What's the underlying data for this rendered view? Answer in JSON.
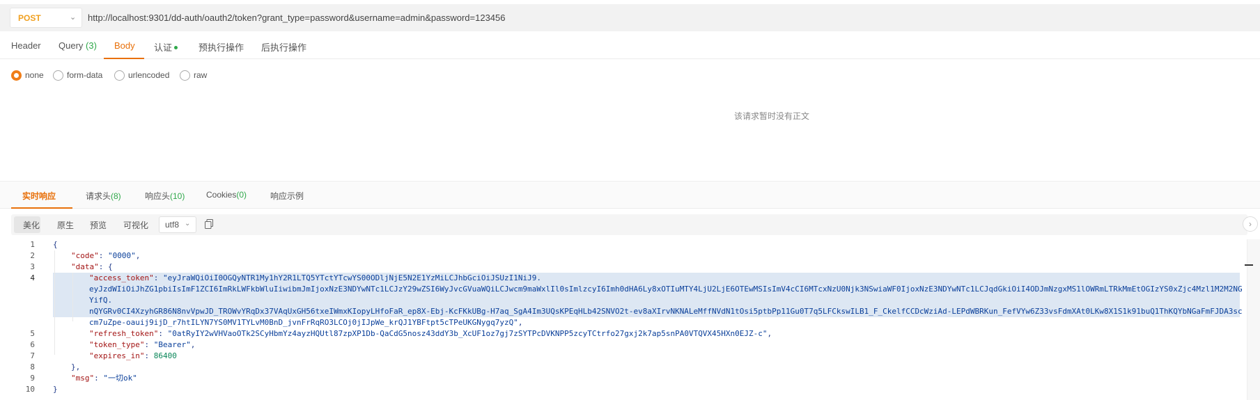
{
  "request": {
    "method": "POST",
    "url": "http://localhost:9301/dd-auth/oauth2/token?grant_type=password&username=admin&password=123456"
  },
  "request_tabs": [
    {
      "label": "Header",
      "count": ""
    },
    {
      "label": "Query",
      "count": "(3)"
    },
    {
      "label": "Body",
      "count": ""
    },
    {
      "label": "认证",
      "count": ""
    },
    {
      "label": "预执行操作",
      "count": ""
    },
    {
      "label": "后执行操作",
      "count": ""
    }
  ],
  "active_request_tab": "Body",
  "body_types": [
    {
      "label": "none",
      "selected": true
    },
    {
      "label": "form-data",
      "selected": false
    },
    {
      "label": "urlencoded",
      "selected": false
    },
    {
      "label": "raw",
      "selected": false
    }
  ],
  "body_empty_text": "该请求暂时没有正文",
  "response_tabs": [
    {
      "label": "实时响应",
      "count": ""
    },
    {
      "label": "请求头",
      "count": "(8)"
    },
    {
      "label": "响应头",
      "count": "(10)"
    },
    {
      "label": "Cookies",
      "count": "(0)"
    },
    {
      "label": "响应示例",
      "count": ""
    }
  ],
  "active_response_tab": "实时响应",
  "view_modes": [
    "美化",
    "原生",
    "预览",
    "可视化"
  ],
  "active_view_mode": "美化",
  "encoding": "utf8",
  "code": {
    "line_numbers": [
      "1",
      "2",
      "3",
      "4",
      "5",
      "6",
      "7",
      "8",
      "9",
      "10"
    ],
    "current_line": "4",
    "open_brace": "{",
    "close_brace": "}",
    "code_key": "\"code\"",
    "code_value": "\"0000\"",
    "data_key": "\"data\"",
    "access_token_key": "\"access_token\"",
    "access_token_value_1": "\"eyJraWQiOiI0OGQyNTR1My1hY2R1LTQ5YTctYTcwYS00ODljNjE5N2E1YzMiLCJhbGciOiJSUzI1NiJ9.",
    "access_token_value_2": "eyJzdWIiOiJhZG1pbiIsImF1ZCI6ImRkLWFkbWluIiwibmJmIjoxNzE3NDYwNTc1LCJzY29wZSI6WyJvcGVuaWQiLCJwcm9maWxlIl0sImlzcyI6Imh0dHA6Ly8xOTIuMTY4LjU2LjE6OTEwMSIsImV4cCI6MTcxNzU0Njk3NSwiaWF0IjoxNzE3NDYwNTc1LCJqdGkiOiI4ODJmNzgxMS1lOWRmLTRkMmEtOGIzYS0xZjc4Mzl1M2M2NG",
    "access_token_value_3": "YifQ.",
    "access_token_value_4": "nQYGRv0CI4XzyhGR86N8nvVpwJD_TROWvYRqDx37VAqUxGH56txeIWmxKIopyLHfoFaR_ep8X-Ebj-KcFKkUBg-H7aq_SgA4Im3UQsKPEqHLb42SNVO2t-ev8aXIrvNKNALeMffNVdN1tOsi5ptbPp11Gu0T7q5LFCkswILB1_F_CkelfCCDcWziAd-LEPdWBRKun_FefVYw6Z33vsFdmXAt0LKw8X1S1k91buQ1ThKQYbNGaFmFJDA3sc",
    "access_token_value_5": "cm7uZpe-oauij9ijD_r7htILYN7YS0MV1TYLvM0BnD_jvnFrRqRO3LCOj0jIJpWe_krQJ1YBFtpt5cTPeUKGNygq7yzQ\"",
    "refresh_token_key": "\"refresh_token\"",
    "refresh_token_value": "\"0atRyIY2wVHVaoOTk2SCyHbmYz4ayzHQUtl87zpXP1Db-QaCdG5nosz43ddY3b_XcUF1oz7gj7zSYTPcDVKNPP5zcyTCtrfo27gxj2k7ap5snPA0VTQVX45HXn0EJZ-c\"",
    "token_type_key": "\"token_type\"",
    "token_type_value": "\"Bearer\"",
    "expires_in_key": "\"expires_in\"",
    "expires_in_value": "86400",
    "msg_key": "\"msg\"",
    "msg_value": "\"一切ok\""
  },
  "colors": {
    "accent": "#e8700a",
    "method": "#f0a020",
    "count": "#2fa84a",
    "selection": "#dde7f3"
  }
}
